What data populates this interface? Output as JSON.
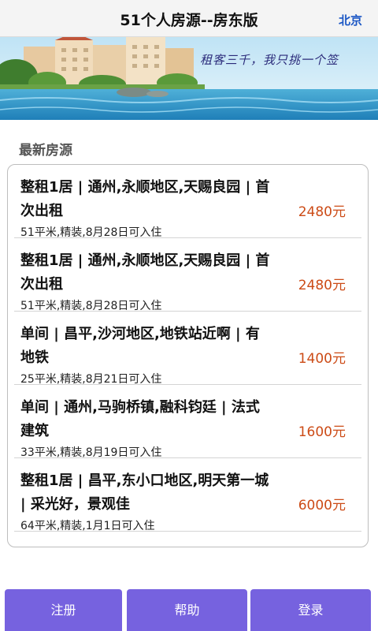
{
  "header": {
    "title": "51个人房源--房东版",
    "city": "北京"
  },
  "banner": {
    "slogan": "租客三千，我只挑一个签"
  },
  "section": {
    "title": "最新房源"
  },
  "listings": [
    {
      "name": "整租1居 | 通州,永顺地区,天赐良园 | 首次出租",
      "desc": "51平米,精装,8月28日可入住",
      "price": "2480元"
    },
    {
      "name": "整租1居 | 通州,永顺地区,天赐良园 | 首次出租",
      "desc": "51平米,精装,8月28日可入住",
      "price": "2480元"
    },
    {
      "name": "单间 | 昌平,沙河地区,地铁站近啊 | 有地铁",
      "desc": "25平米,精装,8月21日可入住",
      "price": "1400元"
    },
    {
      "name": "单间 | 通州,马驹桥镇,融科钧廷 | 法式建筑",
      "desc": "33平米,精装,8月19日可入住",
      "price": "1600元"
    },
    {
      "name": "整租1居 | 昌平,东小口地区,明天第一城 | 采光好，景观佳",
      "desc": "64平米,精装,1月1日可入住",
      "price": "6000元"
    }
  ],
  "footer": {
    "register": "注册",
    "help": "帮助",
    "login": "登录"
  },
  "colors": {
    "accent": "#7662df",
    "price": "#cc4b16",
    "city_link": "#1a56c4"
  }
}
